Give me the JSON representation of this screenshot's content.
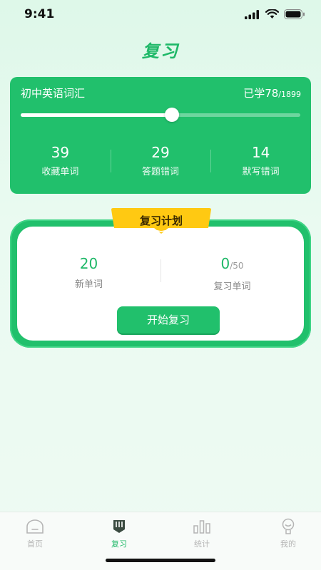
{
  "status": {
    "time": "9:41"
  },
  "header": {
    "title": "复习"
  },
  "vocab": {
    "name": "初中英语词汇",
    "learned_prefix": "已学78",
    "total": "/1899",
    "progress_fraction": 0.54,
    "stats": [
      {
        "value": "39",
        "label": "收藏单词"
      },
      {
        "value": "29",
        "label": "答题错词"
      },
      {
        "value": "14",
        "label": "默写错词"
      }
    ]
  },
  "plan": {
    "title": "复习计划",
    "new_words": {
      "value": "20",
      "label": "新单词"
    },
    "review_words": {
      "value": "0",
      "total": "/50",
      "label": "复习单词"
    },
    "start_label": "开始复习"
  },
  "tabs": [
    {
      "label": "首页",
      "icon": "home-icon"
    },
    {
      "label": "复习",
      "icon": "review-icon"
    },
    {
      "label": "统计",
      "icon": "stats-icon"
    },
    {
      "label": "我的",
      "icon": "profile-icon"
    }
  ],
  "colors": {
    "accent": "#21c06c",
    "ribbon": "#ffc912",
    "inactive": "#b5b5b5"
  }
}
